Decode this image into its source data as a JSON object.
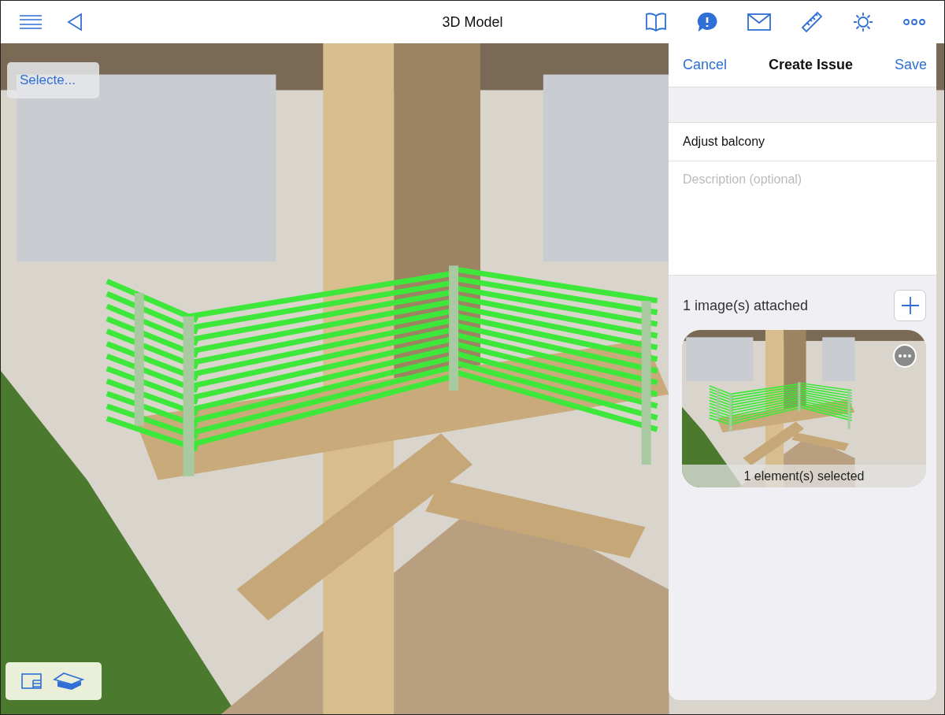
{
  "nav": {
    "title": "3D Model"
  },
  "toolbar": [
    {
      "kind": "book",
      "selected": false
    },
    {
      "kind": "issue",
      "selected": true
    },
    {
      "kind": "mail",
      "selected": false
    },
    {
      "kind": "ruler",
      "selected": false
    },
    {
      "kind": "sun",
      "selected": false
    },
    {
      "kind": "more",
      "selected": false
    }
  ],
  "viewport": {
    "selection_button": "Selecte..."
  },
  "panel": {
    "cancel": "Cancel",
    "title": "Create Issue",
    "save": "Save",
    "issue_title": "Adjust balcony",
    "description_placeholder": "Description (optional)",
    "attachments_label": "1 image(s) attached",
    "attachments": [
      {
        "caption": "1 element(s) selected"
      }
    ]
  }
}
